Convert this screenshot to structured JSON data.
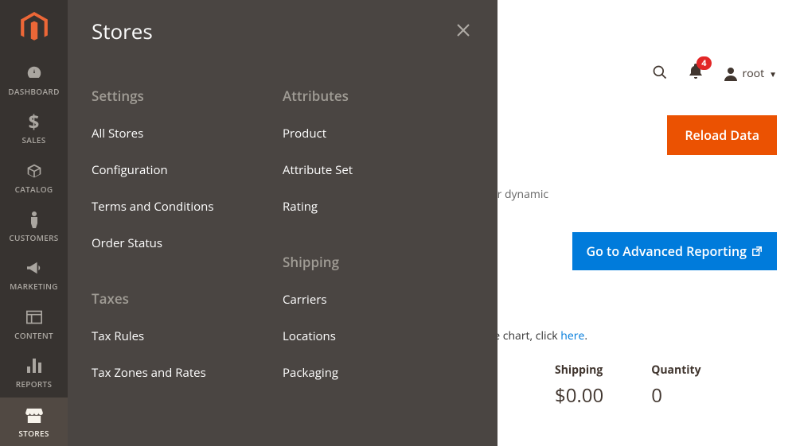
{
  "sidebar": {
    "items": [
      {
        "label": "DASHBOARD",
        "icon": "dashboard"
      },
      {
        "label": "SALES",
        "icon": "dollar"
      },
      {
        "label": "CATALOG",
        "icon": "box"
      },
      {
        "label": "CUSTOMERS",
        "icon": "person"
      },
      {
        "label": "MARKETING",
        "icon": "megaphone"
      },
      {
        "label": "CONTENT",
        "icon": "layout"
      },
      {
        "label": "REPORTS",
        "icon": "bars"
      },
      {
        "label": "STORES",
        "icon": "storefront"
      }
    ],
    "active_index": 7
  },
  "flyout": {
    "title": "Stores",
    "sections_left": [
      {
        "head": "Settings",
        "links": [
          "All Stores",
          "Configuration",
          "Terms and Conditions",
          "Order Status"
        ]
      },
      {
        "head": "Taxes",
        "links": [
          "Tax Rules",
          "Tax Zones and Rates"
        ]
      }
    ],
    "sections_right": [
      {
        "head": "Attributes",
        "links": [
          "Product",
          "Attribute Set",
          "Rating"
        ]
      },
      {
        "head": "Shipping",
        "links": [
          "Carriers",
          "Locations",
          "Packaging"
        ]
      }
    ]
  },
  "header": {
    "notification_count": "4",
    "username": "root"
  },
  "buttons": {
    "reload": "Reload Data",
    "advanced_reporting": "Go to Advanced Reporting"
  },
  "adv_text_fragment": "ur dynamic",
  "chart_hint_prefix": "e chart, click ",
  "chart_hint_link": "here",
  "chart_hint_suffix": ".",
  "stats": {
    "shipping": {
      "label": "Shipping",
      "value": "$0.00"
    },
    "quantity": {
      "label": "Quantity",
      "value": "0"
    },
    "partial_left": ")"
  },
  "colors": {
    "brand_orange": "#eb5202",
    "blue": "#007bdb",
    "red": "#e22626"
  }
}
